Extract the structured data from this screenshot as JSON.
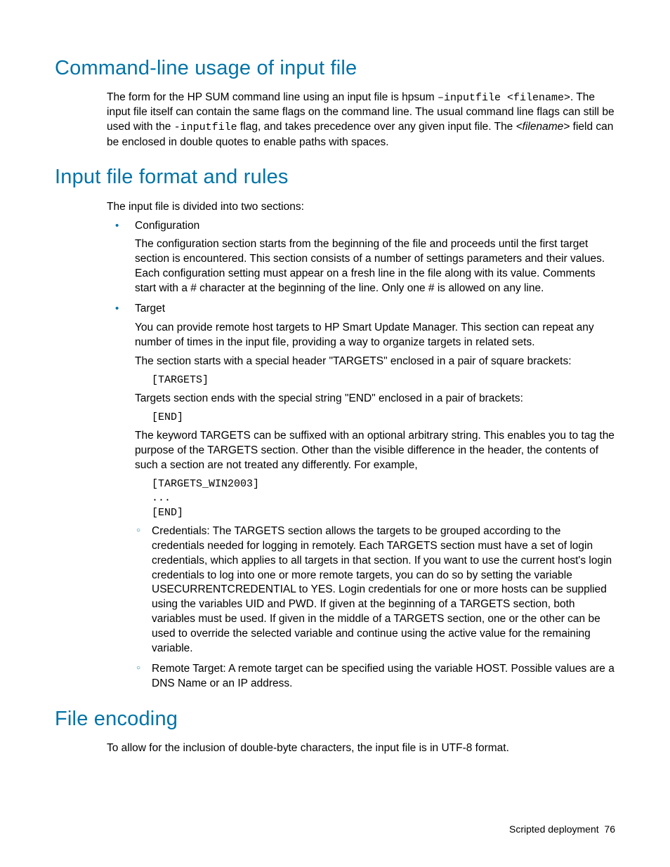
{
  "sections": {
    "cli": {
      "heading": "Command-line usage of input file",
      "p1a": "The form for the HP SUM command line using an input file is hpsum ",
      "p1_code": "–inputfile <filename>",
      "p1b": ". The input file itself can contain the same flags on the command line. The usual command line flags can still be used with the ",
      "p1_code2": "-inputfile",
      "p1c": " flag, and takes precedence over any given input file. The ",
      "p1_em": "<filename>",
      "p1d": " field can be enclosed in double quotes to enable paths with spaces."
    },
    "format": {
      "heading": "Input file format and rules",
      "intro": "The input file is divided into two sections:",
      "config": {
        "title": "Configuration",
        "body": "The configuration section starts from the beginning of the file and proceeds until the first target section is encountered. This section consists of a number of settings parameters and their values. Each configuration setting must appear on a fresh line in the file along with its value. Comments start with a # character at the beginning of the line. Only one # is allowed on any line."
      },
      "target": {
        "title": "Target",
        "p1": "You can provide remote host targets to HP Smart Update Manager. This section can repeat any number of times in the input file, providing a way to organize targets in related sets.",
        "p2": "The section starts with a special header \"TARGETS\" enclosed in a pair of square brackets:",
        "code1": "[TARGETS]",
        "p3": "Targets section ends with the special string \"END\" enclosed in a pair of brackets:",
        "code2": "[END]",
        "p4": "The keyword TARGETS can be suffixed with an optional arbitrary string. This enables you to tag the purpose of the TARGETS section. Other than the visible difference in the header, the contents of such a section are not treated any differently. For example,",
        "code3": "[TARGETS_WIN2003]\n...\n[END]",
        "sub_credentials": "Credentials: The TARGETS section allows the targets to be grouped according to the credentials needed for logging in remotely. Each TARGETS section must have a set of login credentials, which applies to all targets in that section. If you want to use the current host's login credentials to log into one or more remote targets, you can do so by setting the variable USECURRENTCREDENTIAL to YES. Login credentials for one or more hosts can be supplied using the variables UID and PWD. If given at the beginning of a TARGETS section, both variables must be used. If given in the middle of a TARGETS section, one or the other can be used to override the selected variable and continue using the active value for the remaining variable.",
        "sub_remote": "Remote Target: A remote target can be specified using the variable HOST. Possible values are a DNS Name or an IP address."
      }
    },
    "encoding": {
      "heading": "File encoding",
      "body": "To allow for the inclusion of double-byte characters, the input file is in UTF-8 format."
    }
  },
  "footer": {
    "label": "Scripted deployment",
    "page": "76"
  }
}
